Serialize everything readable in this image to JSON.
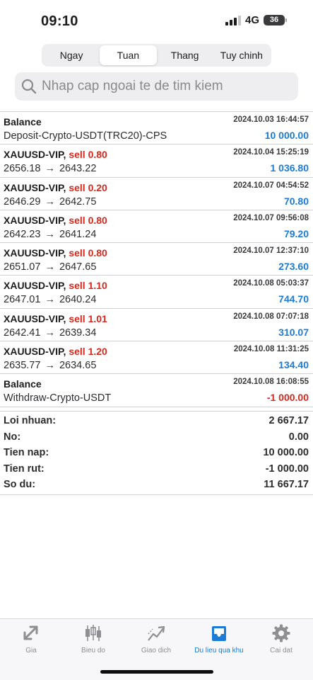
{
  "status_bar": {
    "time": "09:10",
    "network": "4G",
    "battery": "36"
  },
  "segments": [
    {
      "label": "Ngay",
      "active": false
    },
    {
      "label": "Tuan",
      "active": true
    },
    {
      "label": "Thang",
      "active": false
    },
    {
      "label": "Tuy chinh",
      "active": false
    }
  ],
  "search": {
    "placeholder": "Nhap cap ngoai te de tim kiem"
  },
  "history": [
    {
      "title": "Balance",
      "side": "",
      "detail": "Deposit-Crypto-USDT(TRC20)-CPS",
      "time": "2024.10.03 16:44:57",
      "amount": "10 000.00",
      "negative": false
    },
    {
      "title": "XAUUSD-VIP,",
      "side": "sell 0.80",
      "open": "2656.18",
      "close": "2643.22",
      "time": "2024.10.04 15:25:19",
      "amount": "1 036.80",
      "negative": false
    },
    {
      "title": "XAUUSD-VIP,",
      "side": "sell 0.20",
      "open": "2646.29",
      "close": "2642.75",
      "time": "2024.10.07 04:54:52",
      "amount": "70.80",
      "negative": false
    },
    {
      "title": "XAUUSD-VIP,",
      "side": "sell 0.80",
      "open": "2642.23",
      "close": "2641.24",
      "time": "2024.10.07 09:56:08",
      "amount": "79.20",
      "negative": false
    },
    {
      "title": "XAUUSD-VIP,",
      "side": "sell 0.80",
      "open": "2651.07",
      "close": "2647.65",
      "time": "2024.10.07 12:37:10",
      "amount": "273.60",
      "negative": false
    },
    {
      "title": "XAUUSD-VIP,",
      "side": "sell 1.10",
      "open": "2647.01",
      "close": "2640.24",
      "time": "2024.10.08 05:03:37",
      "amount": "744.70",
      "negative": false
    },
    {
      "title": "XAUUSD-VIP,",
      "side": "sell 1.01",
      "open": "2642.41",
      "close": "2639.34",
      "time": "2024.10.08 07:07:18",
      "amount": "310.07",
      "negative": false
    },
    {
      "title": "XAUUSD-VIP,",
      "side": "sell 1.20",
      "open": "2635.77",
      "close": "2634.65",
      "time": "2024.10.08 11:31:25",
      "amount": "134.40",
      "negative": false
    },
    {
      "title": "Balance",
      "side": "",
      "detail": "Withdraw-Crypto-USDT",
      "time": "2024.10.08 16:08:55",
      "amount": "-1 000.00",
      "negative": true
    }
  ],
  "summary": [
    {
      "label": "Loi nhuan:",
      "value": "2 667.17"
    },
    {
      "label": "No:",
      "value": "0.00"
    },
    {
      "label": "Tien nap:",
      "value": "10 000.00"
    },
    {
      "label": "Tien rut:",
      "value": "-1 000.00"
    },
    {
      "label": "So du:",
      "value": "11 667.17"
    }
  ],
  "tabs": [
    {
      "label": "Gia",
      "icon": "price-icon",
      "active": false
    },
    {
      "label": "Bieu do",
      "icon": "candlestick-chart-icon",
      "active": false
    },
    {
      "label": "Giao dich",
      "icon": "trade-icon",
      "active": false
    },
    {
      "label": "Du lieu qua khu",
      "icon": "inbox-history-icon",
      "active": true
    },
    {
      "label": "Cai dat",
      "icon": "gear-icon",
      "active": false
    }
  ],
  "colors": {
    "accent": "#1a7cd6",
    "sell": "#d6281c",
    "negative": "#d6281c"
  }
}
